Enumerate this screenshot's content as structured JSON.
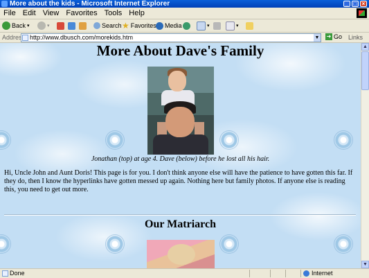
{
  "window": {
    "title": "More about the kids - Microsoft Internet Explorer"
  },
  "menu": [
    "File",
    "Edit",
    "View",
    "Favorites",
    "Tools",
    "Help"
  ],
  "toolbar": {
    "back": "Back",
    "search": "Search",
    "favorites": "Favorites",
    "media": "Media"
  },
  "address": {
    "label": "Address",
    "url": "http://www.dbusch.com/morekids.htm",
    "go": "Go",
    "links": "Links"
  },
  "page": {
    "title": "More About Dave's Family",
    "caption": "Jonathan (top) at age 4.  Dave (below) before he lost all his hair.",
    "intro": "Hi, Uncle John and Aunt Doris! This page is for you. I don't think anyone else will have the patience to have gotten this far. If they do, then I know the hyperlinks have gotten messed up again. Nothing here but family photos.  If anyone else is reading this, you need to get out more.",
    "section_title": "Our Matriarch"
  },
  "status": {
    "text": "Done",
    "zone": "Internet"
  }
}
